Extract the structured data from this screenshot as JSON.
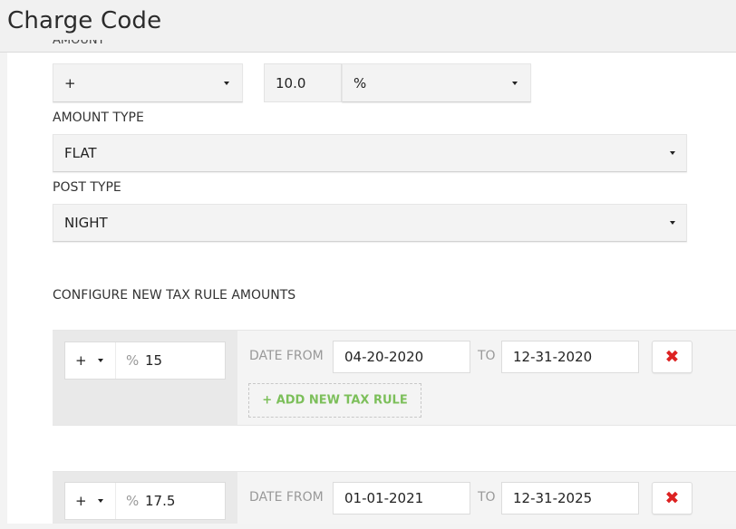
{
  "header": {
    "title": "Charge Code"
  },
  "form": {
    "amount": {
      "label_clipped": "AMOUNT",
      "operator": "+",
      "value": "10.0",
      "unit": "%"
    },
    "amount_type": {
      "label": "AMOUNT TYPE",
      "value": "FLAT"
    },
    "post_type": {
      "label": "POST TYPE",
      "value": "NIGHT"
    }
  },
  "tax_rules": {
    "section_label": "CONFIGURE NEW TAX RULE AMOUNTS",
    "date_from_label": "DATE FROM",
    "to_label": "TO",
    "add_button_label": "+ ADD NEW TAX RULE",
    "delete_icon": "close-icon",
    "rows": [
      {
        "operator": "+",
        "pct_symbol": "%",
        "amount": "15",
        "date_from": "04-20-2020",
        "date_to": "12-31-2020"
      },
      {
        "operator": "+",
        "pct_symbol": "%",
        "amount": "17.5",
        "date_from": "01-01-2021",
        "date_to": "12-31-2025"
      }
    ]
  },
  "colors": {
    "delete": "#dd2222",
    "add_rule": "#7cbf5a"
  }
}
